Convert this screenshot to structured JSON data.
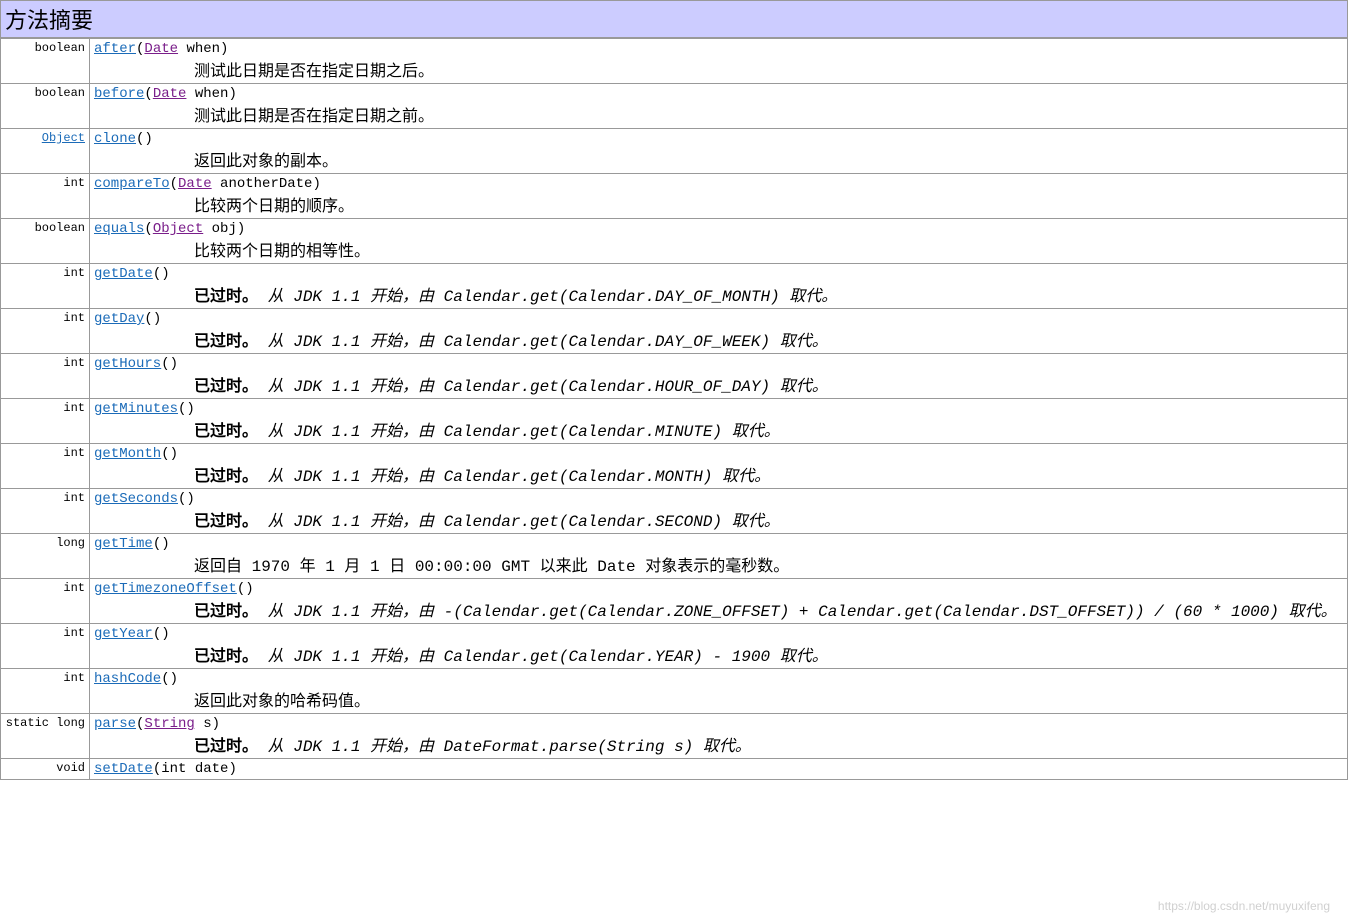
{
  "title": "方法摘要",
  "deprecated_label": "已过时。",
  "watermark": "https://blog.csdn.net/muyuxifeng",
  "rows": [
    {
      "ret": "boolean",
      "ret_link": false,
      "method": "after",
      "params": [
        {
          "type": "Date",
          "link": true,
          "name": "when"
        }
      ],
      "desc": "测试此日期是否在指定日期之后。",
      "deprecated": false
    },
    {
      "ret": "boolean",
      "ret_link": false,
      "method": "before",
      "params": [
        {
          "type": "Date",
          "link": true,
          "name": "when"
        }
      ],
      "desc": "测试此日期是否在指定日期之前。",
      "deprecated": false
    },
    {
      "ret": "Object",
      "ret_link": true,
      "method": "clone",
      "params": [],
      "desc": "返回此对象的副本。",
      "deprecated": false
    },
    {
      "ret": "int",
      "ret_link": false,
      "method": "compareTo",
      "params": [
        {
          "type": "Date",
          "link": true,
          "name": "anotherDate"
        }
      ],
      "desc": "比较两个日期的顺序。",
      "deprecated": false
    },
    {
      "ret": "boolean",
      "ret_link": false,
      "method": "equals",
      "params": [
        {
          "type": "Object",
          "link": true,
          "name": "obj"
        }
      ],
      "desc": "比较两个日期的相等性。",
      "deprecated": false
    },
    {
      "ret": "int",
      "ret_link": false,
      "method": "getDate",
      "params": [],
      "desc": "从 JDK 1.1 开始，由 Calendar.get(Calendar.DAY_OF_MONTH) 取代。",
      "deprecated": true
    },
    {
      "ret": "int",
      "ret_link": false,
      "method": "getDay",
      "params": [],
      "desc": "从 JDK 1.1 开始，由 Calendar.get(Calendar.DAY_OF_WEEK) 取代。",
      "deprecated": true
    },
    {
      "ret": "int",
      "ret_link": false,
      "method": "getHours",
      "params": [],
      "desc": "从 JDK 1.1 开始，由 Calendar.get(Calendar.HOUR_OF_DAY) 取代。",
      "deprecated": true
    },
    {
      "ret": "int",
      "ret_link": false,
      "method": "getMinutes",
      "params": [],
      "desc": "从 JDK 1.1 开始，由 Calendar.get(Calendar.MINUTE) 取代。",
      "deprecated": true
    },
    {
      "ret": "int",
      "ret_link": false,
      "method": "getMonth",
      "params": [],
      "desc": "从 JDK 1.1 开始，由 Calendar.get(Calendar.MONTH) 取代。",
      "deprecated": true
    },
    {
      "ret": "int",
      "ret_link": false,
      "method": "getSeconds",
      "params": [],
      "desc": "从 JDK 1.1 开始，由 Calendar.get(Calendar.SECOND) 取代。",
      "deprecated": true
    },
    {
      "ret": "long",
      "ret_link": false,
      "method": "getTime",
      "params": [],
      "desc": "返回自 1970 年 1 月 1 日 00:00:00 GMT 以来此 Date 对象表示的毫秒数。",
      "deprecated": false
    },
    {
      "ret": "int",
      "ret_link": false,
      "method": "getTimezoneOffset",
      "params": [],
      "desc": "从 JDK 1.1 开始，由 -(Calendar.get(Calendar.ZONE_OFFSET) + Calendar.get(Calendar.DST_OFFSET)) / (60 * 1000) 取代。",
      "deprecated": true
    },
    {
      "ret": "int",
      "ret_link": false,
      "method": "getYear",
      "params": [],
      "desc": "从 JDK 1.1 开始，由 Calendar.get(Calendar.YEAR) - 1900 取代。",
      "deprecated": true
    },
    {
      "ret": "int",
      "ret_link": false,
      "method": "hashCode",
      "params": [],
      "desc": "返回此对象的哈希码值。",
      "deprecated": false
    },
    {
      "ret": "static long",
      "ret_link": false,
      "method": "parse",
      "params": [
        {
          "type": "String",
          "link": true,
          "name": "s"
        }
      ],
      "desc": "从 JDK 1.1 开始，由 DateFormat.parse(String s) 取代。",
      "deprecated": true
    },
    {
      "ret": "void",
      "ret_link": false,
      "method": "setDate",
      "params": [
        {
          "type": "int",
          "link": false,
          "name": "date"
        }
      ],
      "desc": "",
      "deprecated": false,
      "partial": true
    }
  ]
}
